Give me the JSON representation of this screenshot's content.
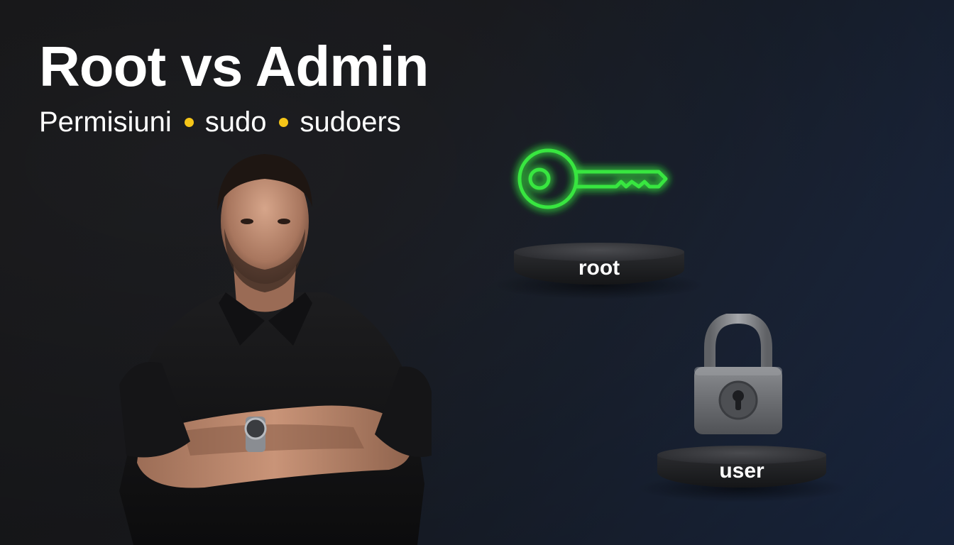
{
  "title": "Root vs Admin",
  "subtitle": {
    "items": [
      "Permisiuni",
      "sudo",
      "sudoers"
    ],
    "separator_color": "#f5c518"
  },
  "pedestals": {
    "root_label": "root",
    "user_label": "user"
  },
  "icons": {
    "key": "key-icon",
    "lock": "padlock-icon",
    "key_color": "#39e640"
  },
  "colors": {
    "background_left": "#1b1b1d",
    "background_right": "#223457",
    "text": "#ffffff"
  }
}
